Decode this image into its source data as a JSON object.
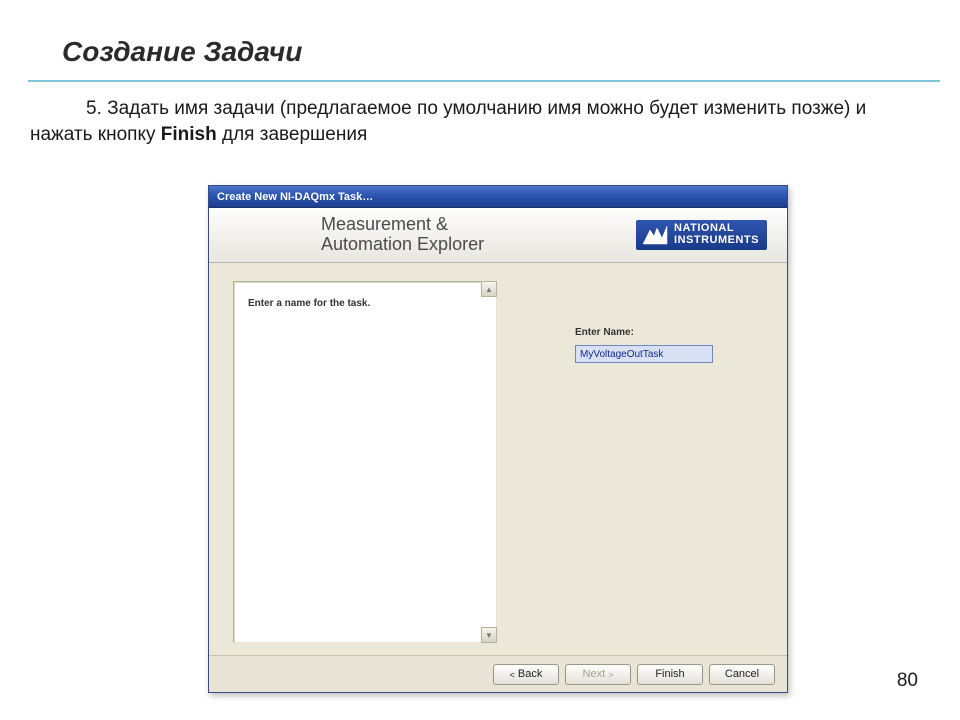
{
  "slide": {
    "title": "Создание Задачи",
    "step_prefix": "5. ",
    "step_text_part1": "Задать имя задачи (предлагаемое по умолчанию имя можно будет изменить позже) и нажать кнопку ",
    "step_bold": "Finish",
    "step_text_part2": " для завершения",
    "page_number": "80"
  },
  "dialog": {
    "titlebar": "Create New NI-DAQmx Task…",
    "banner_line1": "Measurement &",
    "banner_line2": "Automation Explorer",
    "logo_top": "NATIONAL",
    "logo_bottom": "INSTRUMENTS",
    "left_instruction": "Enter a name for the task.",
    "label_enter_name": "Enter Name:",
    "task_name_value": "MyVoltageOutTask",
    "buttons": {
      "back": "Back",
      "next": "Next",
      "finish": "Finish",
      "cancel": "Cancel"
    }
  }
}
